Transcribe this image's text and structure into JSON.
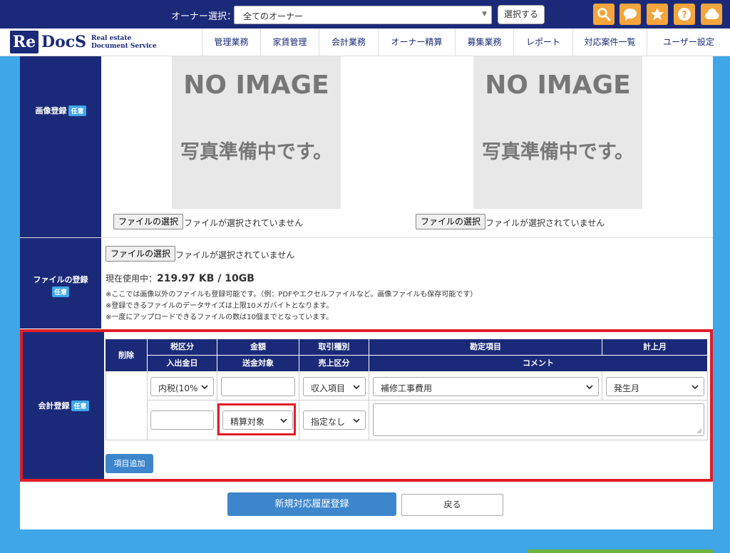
{
  "topbar": {
    "owner_label": "オーナー選択：",
    "owner_value": "全てのオーナー",
    "select_button": "選択する",
    "icons": [
      "search-icon",
      "chat-icon",
      "star-icon",
      "help-icon",
      "cloud-icon"
    ],
    "colors": {
      "bar": "#1b2a78",
      "icon_bg": "#f4a53c"
    }
  },
  "logo": {
    "re": "Re",
    "docs": "DocS",
    "sub1": "Real estate",
    "sub2": "Document Service"
  },
  "nav": [
    "管理業務",
    "家賃管理",
    "会計業務",
    "オーナー精算",
    "募集業務",
    "レポート",
    "対応案件一覧",
    "ユーザー設定"
  ],
  "image_section": {
    "label": "画像登録",
    "badge": "任意",
    "placeholder_title": "NO IMAGE",
    "placeholder_sub": "写真準備中です。",
    "file_button": "ファイルの選択",
    "file_status": "ファイルが選択されていません"
  },
  "file_section": {
    "label": "ファイルの登録",
    "badge": "任意",
    "file_button": "ファイルの選択",
    "file_status": "ファイルが選択されていません",
    "usage_label": "現在使用中：",
    "usage_value": "219.97 KB / 10GB",
    "notes": [
      "※ここでは画像以外のファイルも登録可能です。（例：PDFやエクセルファイルなど。画像ファイルも保存可能です）",
      "※登録できるファイルのデータサイズは上限10メガバイトとなります。",
      "※一度にアップロードできるファイルの数は10個までとなっています。"
    ]
  },
  "accounting": {
    "label": "会計登録",
    "badge": "任意",
    "headers": {
      "delete": "削除",
      "tax": "税区分",
      "amount": "金額",
      "trade": "取引種別",
      "account": "勘定項目",
      "month": "計上月",
      "date": "入出金日",
      "transfer": "送金対象",
      "sales": "売上区分",
      "comment": "コメント"
    },
    "row1": {
      "tax": "内税(10%",
      "trade": "収入項目",
      "account": "補修工事費用",
      "month": "発生月"
    },
    "row2": {
      "transfer": "精算対象",
      "sales": "指定なし"
    },
    "add_button": "項目追加",
    "highlight_color": "#e01e28"
  },
  "actions": {
    "submit": "新規対応履歴登録",
    "back": "戻る"
  }
}
